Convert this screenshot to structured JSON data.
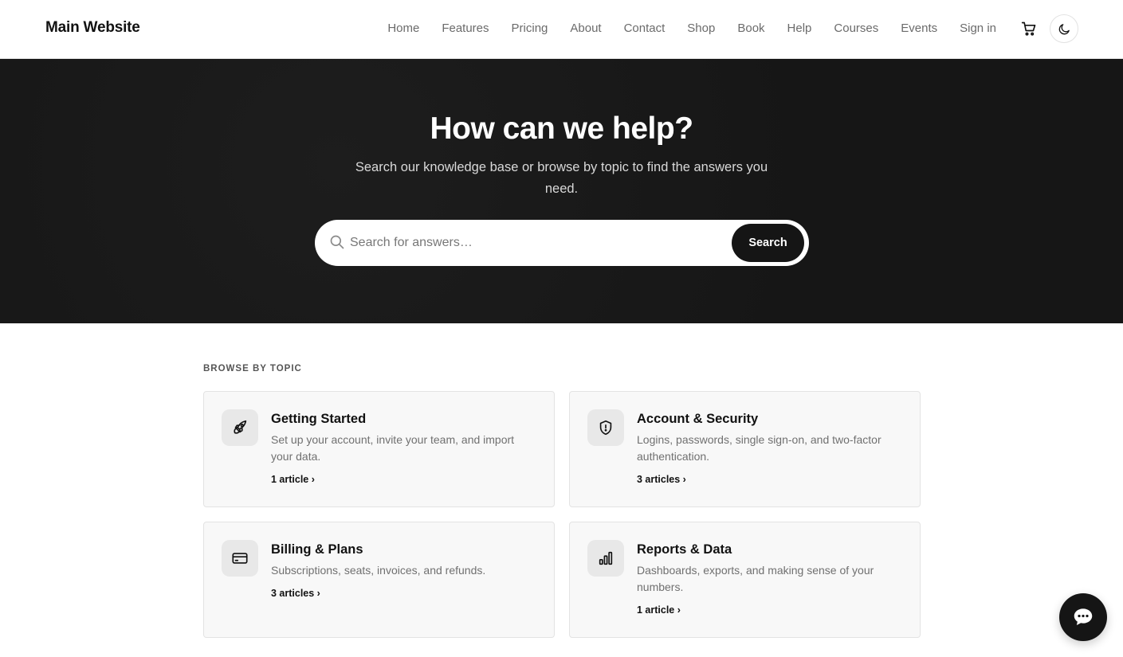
{
  "header": {
    "brand": "Main Website",
    "nav": [
      "Home",
      "Features",
      "Pricing",
      "About",
      "Contact",
      "Shop",
      "Book",
      "Help",
      "Courses",
      "Events",
      "Sign in"
    ],
    "cart_icon": "cart-icon",
    "theme_icon": "moon-icon"
  },
  "hero": {
    "title": "How can we help?",
    "subtitle": "Search our knowledge base or browse by topic to find the answers you need.",
    "search": {
      "placeholder": "Search for answers…",
      "value": "",
      "button_label": "Search",
      "icon": "search-icon"
    }
  },
  "topics": {
    "label": "BROWSE BY TOPIC",
    "cards": [
      {
        "title": "Getting Started",
        "description": "Set up your account, invite your team, and import your data.",
        "count": "1 article ›",
        "icon": "rocket-icon"
      },
      {
        "title": "Account & Security",
        "description": "Logins, passwords, single sign-on, and two-factor authentication.",
        "count": "3 articles ›",
        "icon": "shield-icon"
      },
      {
        "title": "Billing & Plans",
        "description": "Subscriptions, seats, invoices, and refunds.",
        "count": "3 articles ›",
        "icon": "credit-card-icon"
      },
      {
        "title": "Reports & Data",
        "description": "Dashboards, exports, and making sense of your numbers.",
        "count": "1 article ›",
        "icon": "bar-chart-icon"
      }
    ]
  },
  "chat": {
    "icon": "chat-icon"
  },
  "colors": {
    "hero_bg": "#161616",
    "accent": "#151515",
    "card_bg": "#f8f8f8"
  }
}
